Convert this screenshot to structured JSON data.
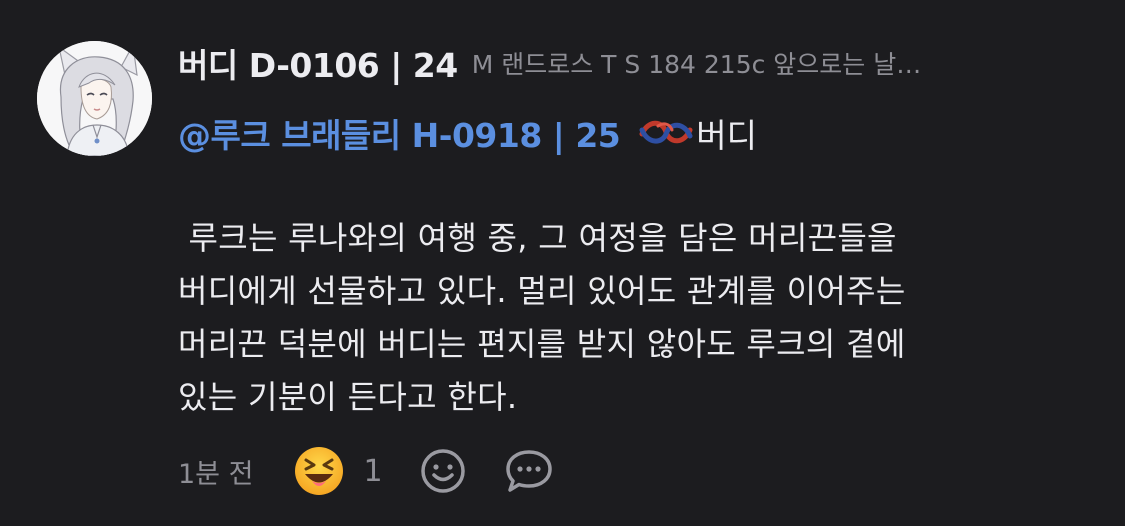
{
  "comment": {
    "author": "버디 D-0106 | 24",
    "meta": "M 랜드로스 T S 184 215c 앞으로는 날…",
    "mention": "@루크 브래들리 H-0918 | 25",
    "mention_suffix": "버디",
    "body": " 루크는 루나와의 여행 중, 그 여정을 담은 머리끈들을\n버디에게 선물하고 있다. 멀리 있어도 관계를 이어주는\n머리끈 덕분에 버디는 편지를 받지 않아도 루크의 곁에\n있는 기분이 든다고 한다.",
    "time": "1분 전",
    "reaction": {
      "emoji": "squinting-face-with-tongue",
      "count": "1"
    }
  },
  "icons": {
    "add_reaction": "smiley-outline-icon",
    "reply": "speech-bubble-icon"
  },
  "colors": {
    "background": "#1c1c1f",
    "text": "#ececf0",
    "muted": "#8e8e95",
    "mention": "#5b8fe0"
  }
}
